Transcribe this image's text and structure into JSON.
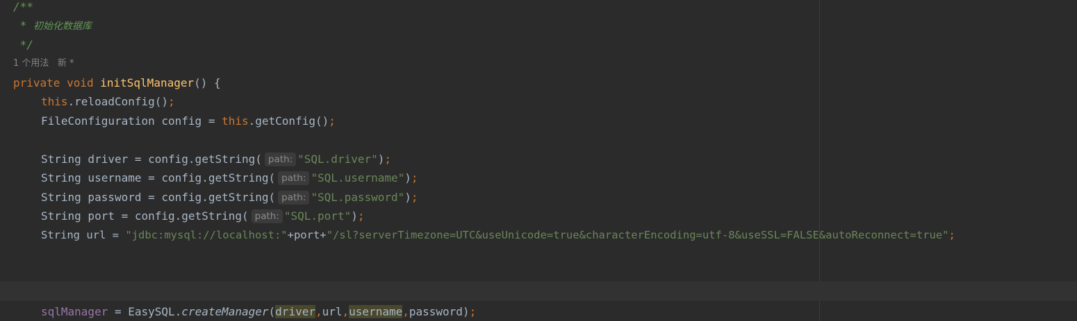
{
  "doc_comment": {
    "open": "/**",
    "star": " * ",
    "text": "初始化数据库",
    "close": " */"
  },
  "usage_hint": {
    "usages": "1 个用法",
    "author": "新 *"
  },
  "method_decl": {
    "mod": "private",
    "ret": "void",
    "name": "initSqlManager",
    "sig": "() {"
  },
  "reload": {
    "this": "this",
    "call": ".reloadConfig()",
    "semi": ";"
  },
  "config_line": {
    "decl": "FileConfiguration config = ",
    "this": "this",
    "call": ".getConfig()",
    "semi": ";"
  },
  "param_hint": "path:",
  "lines": {
    "driver": {
      "decl": "String driver = config.getString(",
      "arg": "\"SQL.driver\"",
      "close": ")"
    },
    "username": {
      "decl": "String username = config.getString(",
      "arg": "\"SQL.username\"",
      "close": ")"
    },
    "password": {
      "decl": "String password = config.getString(",
      "arg": "\"SQL.password\"",
      "close": ")"
    },
    "port": {
      "decl": "String port = config.getString(",
      "arg": "\"SQL.port\"",
      "close": ")"
    }
  },
  "semicolon": ";",
  "url_line": {
    "decl": "String url = ",
    "s1": "\"jdbc:mysql://localhost:\"",
    "mid": "+port+",
    "s2": "\"/sl?serverTimezone=UTC&useUnicode=true&characterEncoding=utf-8&useSSL=FALSE&autoReconnect=true\""
  },
  "manager_line": {
    "field": "sqlManager",
    "assign": " = EasySQL.",
    "method": "createManager",
    "paren_open": "(",
    "arg1": "driver",
    "arg2": "url",
    "arg3": "username",
    "arg4": "password",
    "paren_close": ")",
    "comma": ","
  },
  "colors": {
    "background": "#2b2b2b",
    "text": "#a9b7c6",
    "keyword": "#cc7832",
    "method": "#ffc66d",
    "string": "#6a8759",
    "doc_comment": "#629755",
    "field": "#9876aa"
  }
}
